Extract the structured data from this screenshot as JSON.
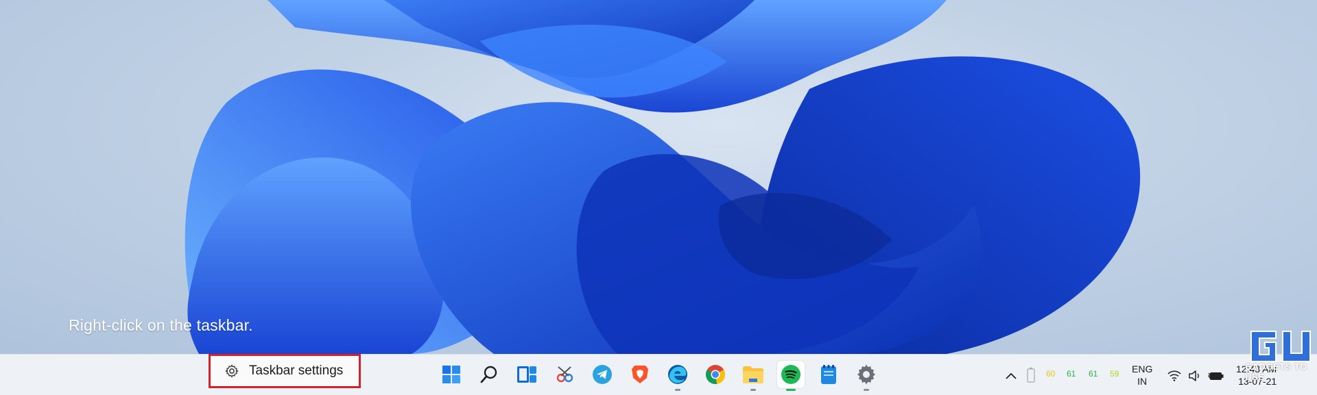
{
  "desktop": {
    "caption": "Right-click on the taskbar."
  },
  "context_menu": {
    "item_label": "Taskbar settings",
    "icon": "gear-icon",
    "highlight_color": "#d2232a"
  },
  "taskbar": {
    "apps": [
      {
        "name": "start-button",
        "icon": "windows-logo-icon"
      },
      {
        "name": "search-button",
        "icon": "search-icon"
      },
      {
        "name": "task-view-button",
        "icon": "task-view-icon"
      },
      {
        "name": "snipping-tool-app",
        "icon": "snipping-tool-icon"
      },
      {
        "name": "telegram-app",
        "icon": "telegram-icon"
      },
      {
        "name": "brave-app",
        "icon": "brave-icon"
      },
      {
        "name": "edge-app",
        "icon": "edge-icon"
      },
      {
        "name": "chrome-app",
        "icon": "chrome-icon"
      },
      {
        "name": "file-explorer-app",
        "icon": "folder-icon"
      },
      {
        "name": "spotify-app",
        "icon": "spotify-icon"
      },
      {
        "name": "notepad-app",
        "icon": "notepad-icon"
      },
      {
        "name": "settings-app",
        "icon": "gear-icon"
      }
    ],
    "tray": {
      "numbers": [
        {
          "value": "60",
          "color": "#e6c619"
        },
        {
          "value": "61",
          "color": "#2bb24c"
        },
        {
          "value": "61",
          "color": "#2bb24c"
        },
        {
          "value": "59",
          "color": "#b7d22a"
        }
      ],
      "lang_line1": "ENG",
      "lang_line2": "IN",
      "time": "12:43 AM",
      "date": "13-07-21"
    }
  },
  "watermark": {
    "text": "GADGETS TO USE"
  },
  "colors": {
    "taskbar_bg": "#eef1f5",
    "accent_blue": "#1f4fe0"
  }
}
